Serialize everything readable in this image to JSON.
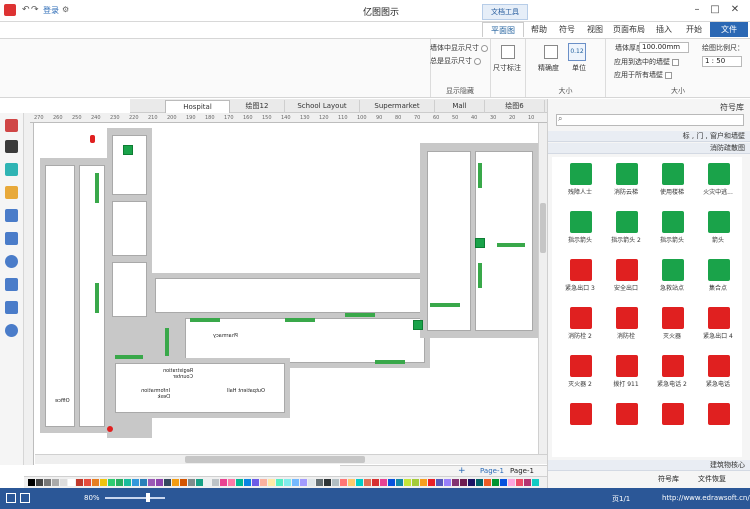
{
  "titlebar": {
    "title": "亿图图示",
    "context_tab": "文档工具",
    "login": "登录"
  },
  "ribbon_tabs": {
    "file": "文件",
    "start": "开始",
    "insert": "插入",
    "page_layout": "页面布局",
    "view": "视图",
    "symbol": "符号",
    "help": "帮助",
    "floorplan": "平面图"
  },
  "ribbon": {
    "scale_group": {
      "name": "大小",
      "label_scale": "绘图比例尺：",
      "scale_value": "1 : 50",
      "label_length": "墙体厚度：",
      "length_value": "100.00mm",
      "opt1": "应用到选中的墙壁",
      "opt2": "应用于所有墙壁"
    },
    "unit_group": {
      "name": "大小",
      "unit": "单位",
      "label1": "精确度",
      "label2": "尺寸标注"
    },
    "display_group": {
      "name": "显示隐藏",
      "opt1": "墙体中显示尺寸",
      "opt2": "总是显示尺寸"
    }
  },
  "doc_tabs": [
    "绘图6",
    "Mall",
    "Supermarket",
    "School Layout",
    "绘图12",
    "Hospital"
  ],
  "ruler_numbers": [
    "270",
    "260",
    "250",
    "240",
    "230",
    "220",
    "210",
    "200",
    "190",
    "180",
    "170",
    "160",
    "150",
    "140",
    "130",
    "120",
    "110",
    "100",
    "90",
    "80",
    "70",
    "60",
    "50",
    "40",
    "30",
    "20",
    "10"
  ],
  "floorplan": {
    "labels": {
      "office": "Office",
      "info_desk": "Information Desk",
      "registration": "Registration Counter",
      "outpatient": "Outpatient Hall",
      "pharmacy": "Pharmacy"
    }
  },
  "page_bar": {
    "page_label": "Page-1",
    "add": "+",
    "page_tab": "Page-1"
  },
  "right_panel": {
    "title": "符号库",
    "search_placeholder": "",
    "library_header1": "标 , 门 , 窗户和墙壁",
    "library_header2": "消防疏散图",
    "symbols": [
      {
        "label": "火灾中逃...",
        "color": "#1aa34a",
        "icon": "emergency-escape-icon"
      },
      {
        "label": "使用楼梯",
        "color": "#1aa34a",
        "icon": "use-stairs-icon"
      },
      {
        "label": "消防云梯",
        "color": "#1aa34a",
        "icon": "fire-ladder-icon"
      },
      {
        "label": "残障人士",
        "color": "#1aa34a",
        "icon": "accessible-icon"
      },
      {
        "label": "箭头",
        "color": "#1aa34a",
        "icon": "arrow-left-icon"
      },
      {
        "label": "指示箭头",
        "color": "#1aa34a",
        "icon": "arrow-right-icon"
      },
      {
        "label": "指示箭头 2",
        "color": "#1aa34a",
        "icon": "arrow-diagonal-icon"
      },
      {
        "label": "指示箭头",
        "color": "#1aa34a",
        "icon": "arrow-downleft-icon"
      },
      {
        "label": "集合点",
        "color": "#1aa34a",
        "icon": "assembly-point-icon"
      },
      {
        "label": "急救站点",
        "color": "#1aa34a",
        "icon": "first-aid-icon"
      },
      {
        "label": "安全出口",
        "color": "#e02020",
        "icon": "exit-person-icon"
      },
      {
        "label": "紧急出口 3",
        "color": "#e02020",
        "icon": "fire-exit-icon"
      },
      {
        "label": "紧急出口 4",
        "color": "#e02020",
        "icon": "fire-wheelchair-icon"
      },
      {
        "label": "灭火器",
        "color": "#e02020",
        "icon": "extinguisher-icon"
      },
      {
        "label": "消防栓",
        "color": "#e02020",
        "icon": "hydrant-icon"
      },
      {
        "label": "消防栓 2",
        "color": "#e02020",
        "icon": "hydrant2-icon"
      },
      {
        "label": "紧急电话",
        "color": "#e02020",
        "icon": "phone-icon"
      },
      {
        "label": "紧急电话 2",
        "color": "#e02020",
        "icon": "phone2-icon"
      },
      {
        "label": "拨打 911",
        "color": "#e02020",
        "icon": "call-icon"
      },
      {
        "label": "灭火器 2",
        "color": "#e02020",
        "icon": "extinguisher2-icon"
      },
      {
        "label": "",
        "color": "#e02020",
        "icon": "fire-hose-icon"
      },
      {
        "label": "",
        "color": "#e02020",
        "icon": "hose-reel-icon"
      },
      {
        "label": "",
        "color": "#e02020",
        "icon": "fire-alarm-icon"
      },
      {
        "label": "",
        "color": "#e02020",
        "icon": "fire-point-icon"
      }
    ],
    "bottom_header": "建筑物核心",
    "bottom_tab1": "符号库",
    "bottom_tab2": "文件恢复"
  },
  "statusbar": {
    "url": "http://www.edrawsoft.cn/",
    "page_info": "页1/1",
    "zoom": "80%"
  },
  "colors": {
    "statusbar": "#2b5797",
    "sign_green": "#1aa34a",
    "sign_red": "#e02020",
    "arrow_green": "#39a84a",
    "file_tab": "#2b68b4"
  }
}
